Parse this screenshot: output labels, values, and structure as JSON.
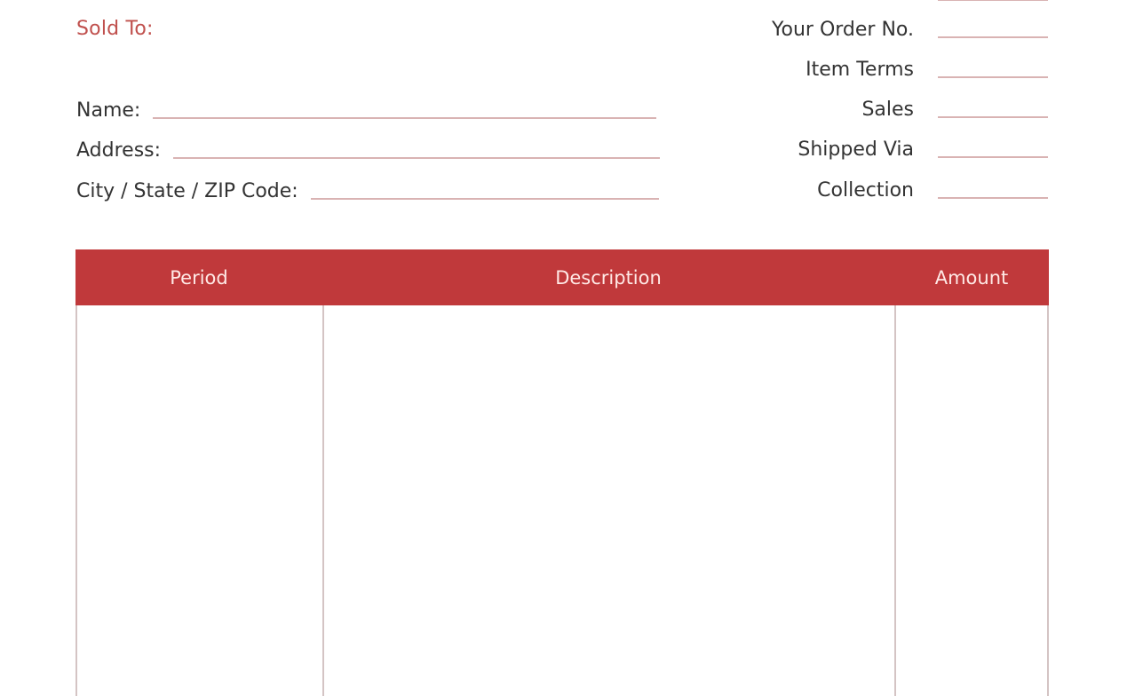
{
  "sold_to": {
    "heading": "Sold To:"
  },
  "customer_fields": [
    {
      "label": "Name:",
      "value": ""
    },
    {
      "label": "Address:",
      "value": ""
    },
    {
      "label": "City / State / ZIP Code:",
      "value": ""
    }
  ],
  "order_fields": [
    {
      "label": "Your Order No.",
      "value": ""
    },
    {
      "label": "Item Terms",
      "value": ""
    },
    {
      "label": "Sales",
      "value": ""
    },
    {
      "label": "Shipped Via",
      "value": ""
    },
    {
      "label": "Collection",
      "value": ""
    }
  ],
  "table": {
    "columns": [
      "Period",
      "Description",
      "Amount"
    ],
    "rows": []
  },
  "colors": {
    "accent": "#c0393b",
    "heading_text": "#c0504d",
    "rule": "#d9b3b3",
    "body_text": "#333333"
  }
}
